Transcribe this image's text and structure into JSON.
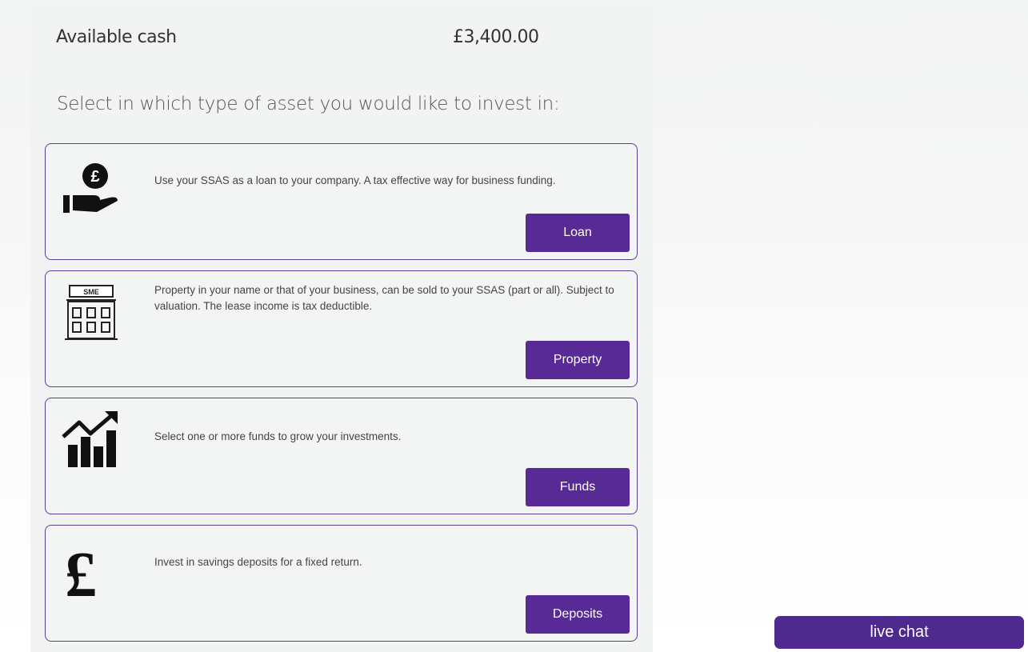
{
  "summary": {
    "cash_label": "Available cash",
    "cash_value": "£3,400.00"
  },
  "prompt": "Select in which type of asset you would like to invest in:",
  "options": [
    {
      "icon": "hand-pound-coin-icon",
      "description": "Use your SSAS as a loan to your company. A tax effective way for business funding.",
      "button_label": "Loan"
    },
    {
      "icon": "sme-building-icon",
      "icon_text": "SME",
      "description": "Property in your name or that of your business, can be sold to your SSAS (part or all). Subject to valuation. The lease income is tax deductible.",
      "button_label": "Property"
    },
    {
      "icon": "growth-chart-icon",
      "description": "Select one or more funds to grow your investments.",
      "button_label": "Funds"
    },
    {
      "icon": "pound-sign-icon",
      "icon_text": "£",
      "description": "Invest in savings deposits for a fixed return.",
      "button_label": "Deposits"
    }
  ],
  "live_chat": {
    "label": "live chat"
  },
  "colors": {
    "accent": "#572a96",
    "border": "#5a3e93",
    "panel_bg": "#f2f3f3"
  }
}
